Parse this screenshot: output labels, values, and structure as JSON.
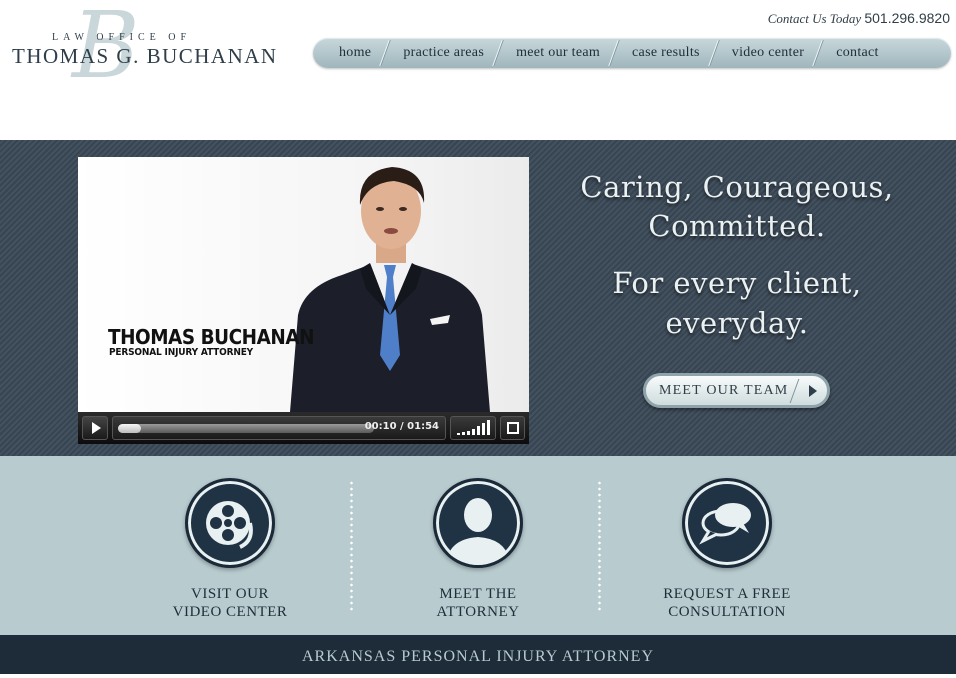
{
  "logo": {
    "monogram": "B",
    "line1": "LAW OFFICE OF",
    "line2": "THOMAS G. BUCHANAN"
  },
  "contact": {
    "label": "Contact Us Today",
    "phone": "501.296.9820"
  },
  "nav": {
    "items": [
      {
        "label": "home"
      },
      {
        "label": "practice areas"
      },
      {
        "label": "meet our team"
      },
      {
        "label": "case results"
      },
      {
        "label": "video center"
      },
      {
        "label": "contact"
      }
    ]
  },
  "video": {
    "name": "THOMAS BUCHANAN",
    "title": "PERSONAL INJURY ATTORNEY",
    "time": "00:10 / 01:54",
    "progress": 0.09
  },
  "hero": {
    "tagline1_line1": "Caring, Courageous,",
    "tagline1_line2": "Committed.",
    "tagline2_line1": "For every client,",
    "tagline2_line2": "everyday.",
    "button_label": "MEET OUR TEAM"
  },
  "features": [
    {
      "icon": "film-reel-icon",
      "line1": "VISIT OUR",
      "line2": "VIDEO CENTER"
    },
    {
      "icon": "person-silhouette-icon",
      "line1": "MEET THE",
      "line2": "ATTORNEY"
    },
    {
      "icon": "speech-bubbles-icon",
      "line1": "REQUEST A FREE",
      "line2": "CONSULTATION"
    }
  ],
  "footer": {
    "text": "ARKANSAS PERSONAL INJURY ATTORNEY"
  },
  "colors": {
    "dark_navy": "#1e2c3a",
    "slate": "#3a4856",
    "light_teal": "#b8cbcf",
    "text_dark": "#2f3e48"
  }
}
